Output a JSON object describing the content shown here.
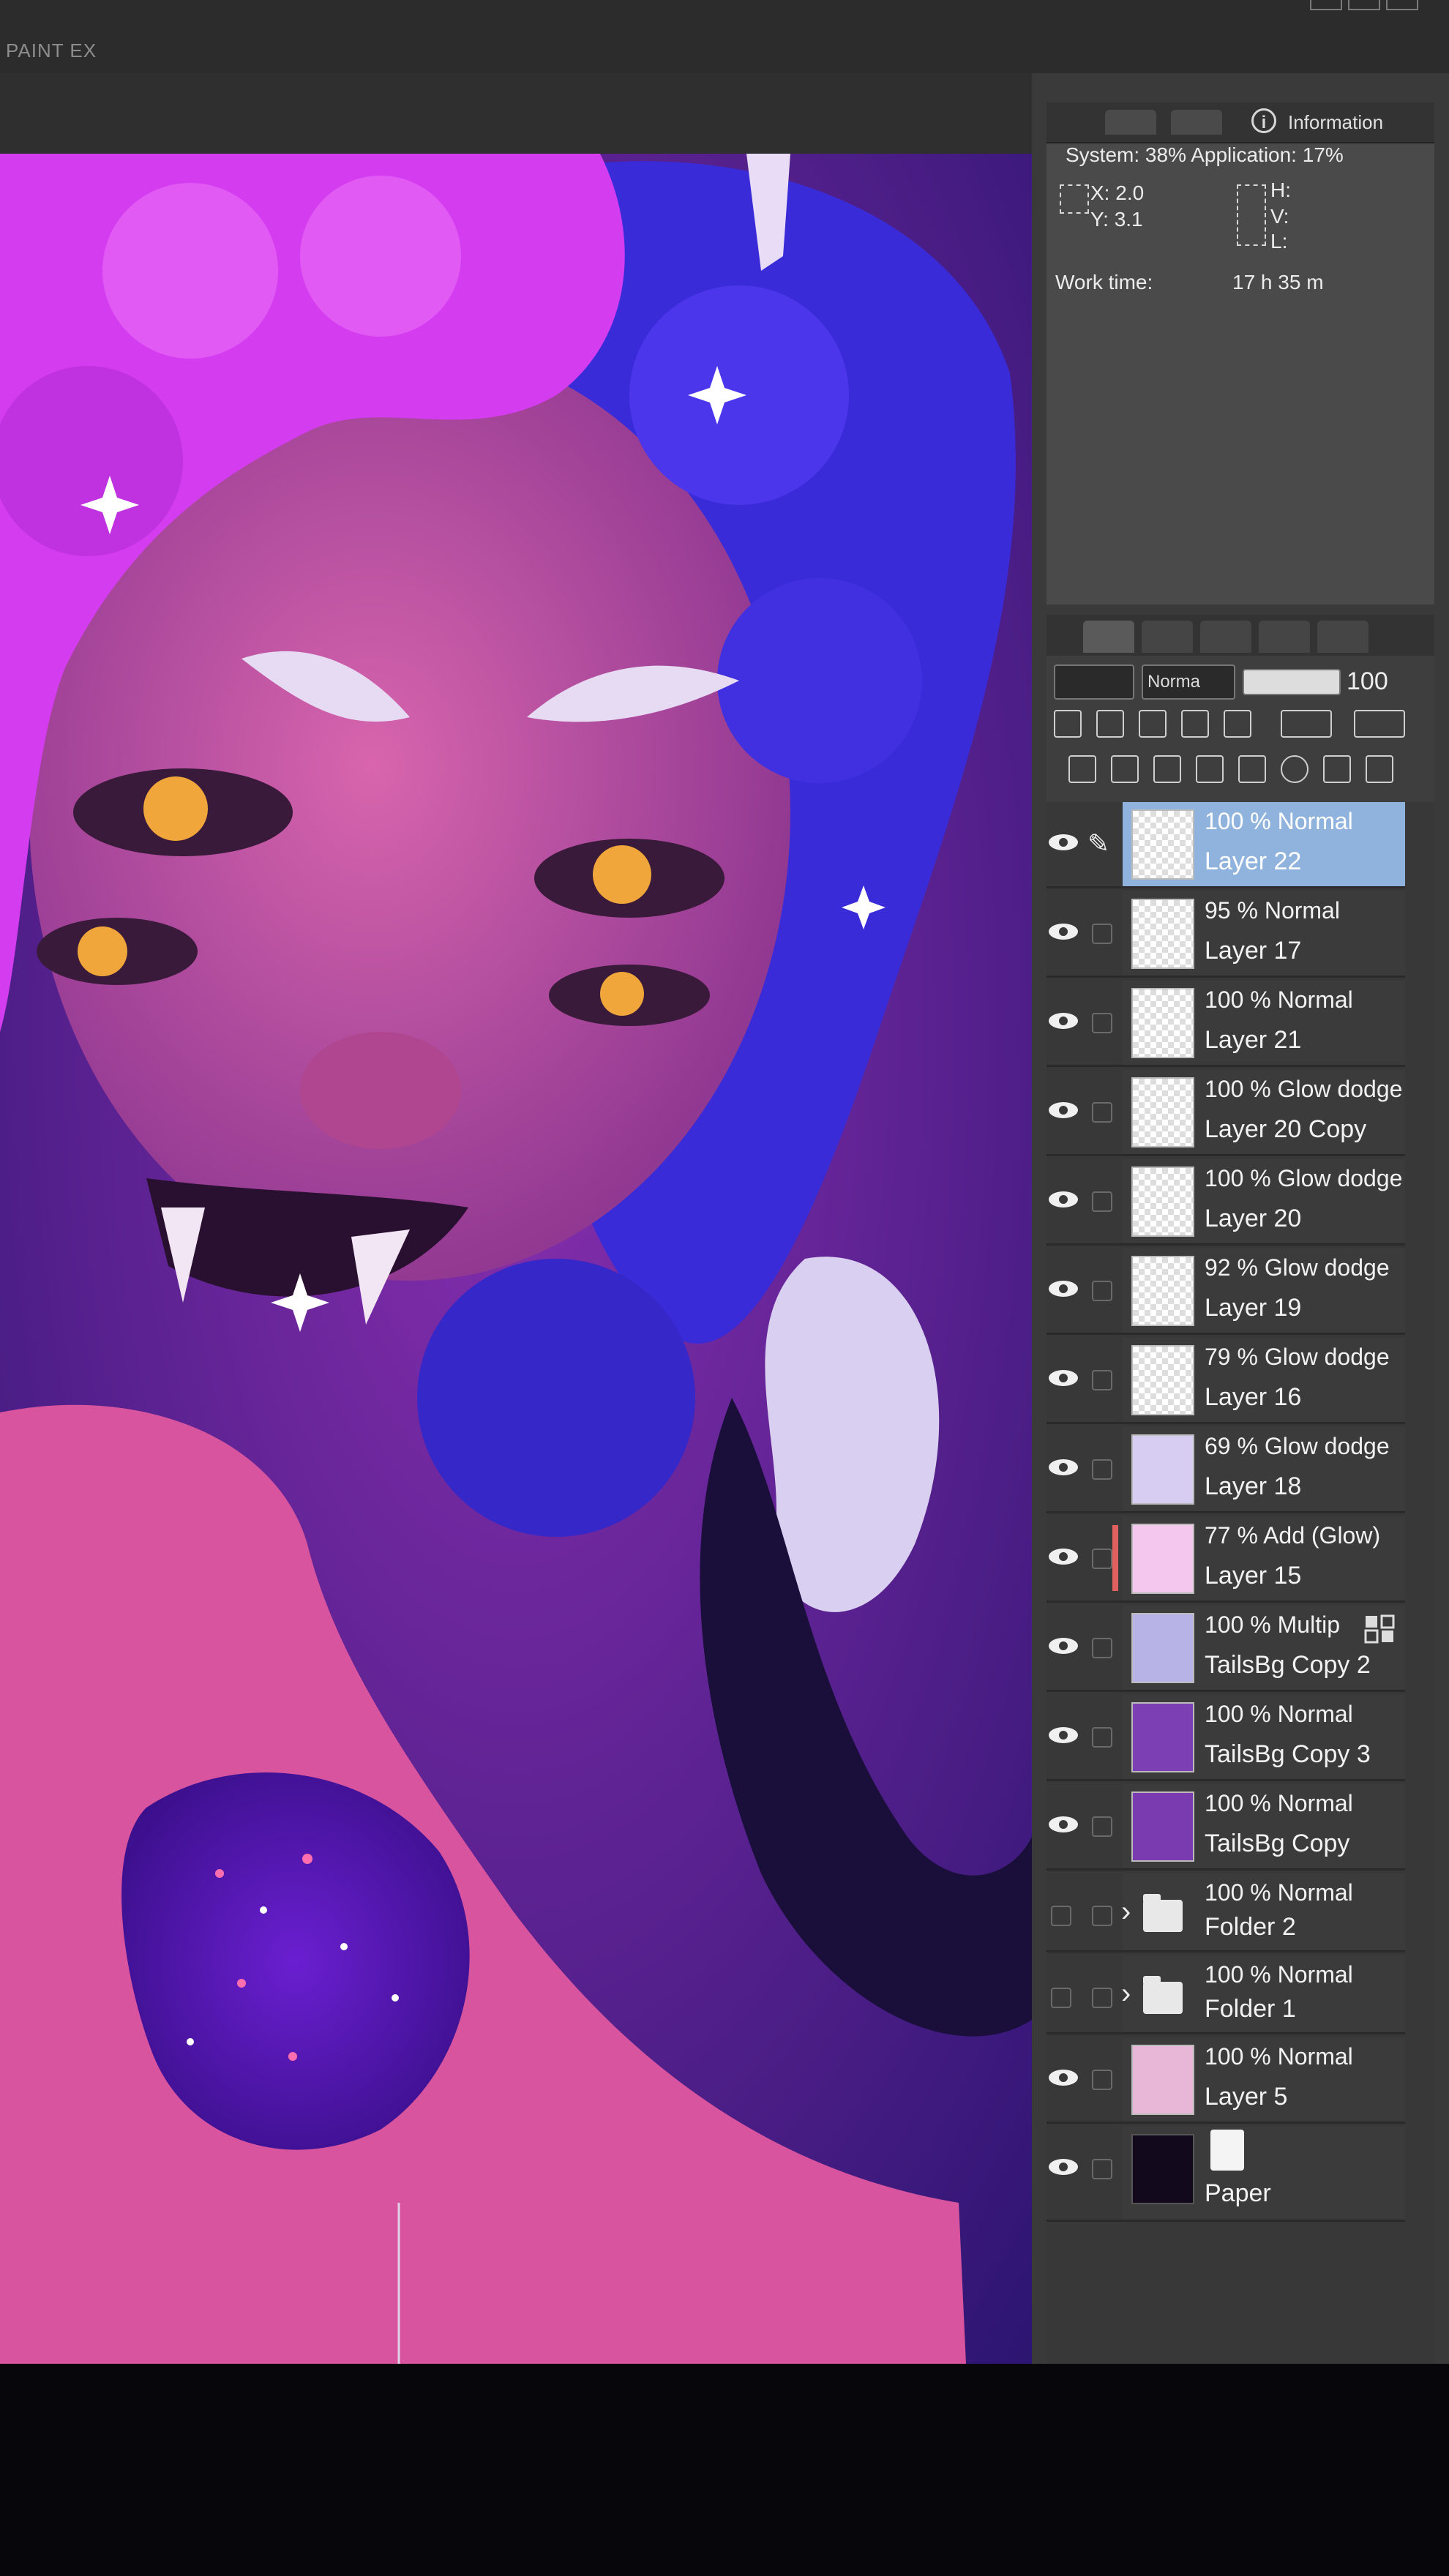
{
  "app": {
    "title": "PAINT EX"
  },
  "info_panel": {
    "tab_label": "Information",
    "system_label": "System:",
    "system_value": "38%",
    "application_label": "Application:",
    "application_value": "17%",
    "x_label": "X:",
    "x_value": "2.0",
    "y_label": "Y:",
    "y_value": "3.1",
    "h_label": "H:",
    "v_label": "V:",
    "l_label": "L:",
    "work_time_label": "Work time:",
    "work_time_value": "17 h 35 m"
  },
  "layer_panel": {
    "blend_mode": "Norma",
    "opacity": "100"
  },
  "layers": [
    {
      "opacity_mode": "100 % Normal",
      "name": "Layer 22",
      "visible": true,
      "selected": true,
      "kind": "raster"
    },
    {
      "opacity_mode": "95 % Normal",
      "name": "Layer 17",
      "visible": true,
      "selected": false,
      "kind": "raster"
    },
    {
      "opacity_mode": "100 % Normal",
      "name": "Layer 21",
      "visible": true,
      "selected": false,
      "kind": "raster"
    },
    {
      "opacity_mode": "100 % Glow dodge",
      "name": "Layer 20 Copy",
      "visible": true,
      "selected": false,
      "kind": "raster"
    },
    {
      "opacity_mode": "100 % Glow dodge",
      "name": "Layer 20",
      "visible": true,
      "selected": false,
      "kind": "raster"
    },
    {
      "opacity_mode": "92 % Glow dodge",
      "name": "Layer 19",
      "visible": true,
      "selected": false,
      "kind": "raster"
    },
    {
      "opacity_mode": "79 % Glow dodge",
      "name": "Layer 16",
      "visible": true,
      "selected": false,
      "kind": "raster"
    },
    {
      "opacity_mode": "69 % Glow dodge",
      "name": "Layer 18",
      "visible": true,
      "selected": false,
      "kind": "raster"
    },
    {
      "opacity_mode": "77 % Add (Glow)",
      "name": "Layer 15",
      "visible": true,
      "selected": false,
      "kind": "raster"
    },
    {
      "opacity_mode": "100 % Multip",
      "name": "TailsBg Copy 2",
      "visible": true,
      "selected": false,
      "kind": "raster"
    },
    {
      "opacity_mode": "100 % Normal",
      "name": "TailsBg Copy 3",
      "visible": true,
      "selected": false,
      "kind": "raster"
    },
    {
      "opacity_mode": "100 % Normal",
      "name": "TailsBg Copy",
      "visible": true,
      "selected": false,
      "kind": "raster"
    },
    {
      "opacity_mode": "100 % Normal",
      "name": "Folder 2",
      "visible": false,
      "selected": false,
      "kind": "folder"
    },
    {
      "opacity_mode": "100 % Normal",
      "name": "Folder 1",
      "visible": false,
      "selected": false,
      "kind": "folder"
    },
    {
      "opacity_mode": "100 % Normal",
      "name": "Layer 5",
      "visible": true,
      "selected": false,
      "kind": "raster"
    },
    {
      "opacity_mode": "",
      "name": "Paper",
      "visible": true,
      "selected": false,
      "kind": "paper"
    }
  ],
  "colors": {
    "selected_layer": "#8fb3dc",
    "panel_bg": "#383838",
    "hair_left": "#d43cf0",
    "hair_right": "#3a2bd8",
    "skin": "#c94fa4",
    "glitter": "#5a1cc0",
    "eye": "#f0a63a"
  }
}
